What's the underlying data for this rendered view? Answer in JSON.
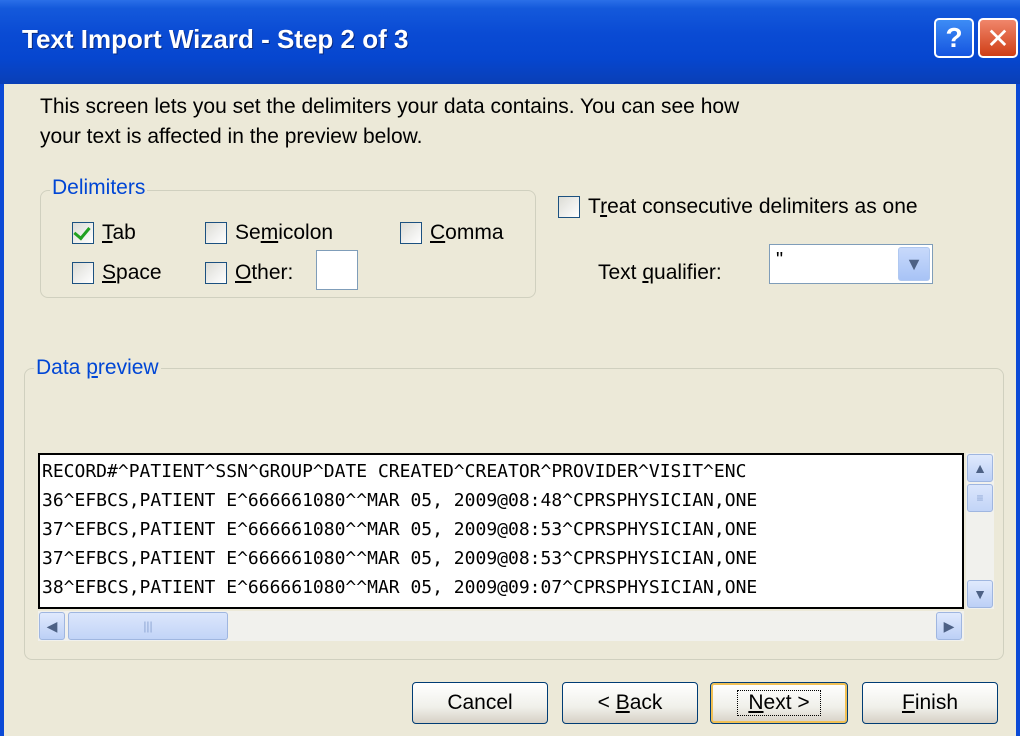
{
  "window": {
    "title": "Text Import Wizard - Step 2 of 3",
    "help_glyph": "?",
    "close_glyph": "✕"
  },
  "description": "This screen lets you set the delimiters your data contains.  You can see how your text is affected in the preview below.",
  "delimiters": {
    "legend": "Delimiters",
    "tab": {
      "label_u": "T",
      "label_rest": "ab",
      "checked": true
    },
    "semicolon": {
      "label_pre": "Se",
      "label_u": "m",
      "label_rest": "icolon",
      "checked": false
    },
    "comma": {
      "label_u": "C",
      "label_rest": "omma",
      "checked": false
    },
    "space": {
      "label_u": "S",
      "label_rest": "pace",
      "checked": false
    },
    "other": {
      "label_u": "O",
      "label_rest": "ther:",
      "checked": false,
      "value": ""
    }
  },
  "consecutive": {
    "label_pre": "T",
    "label_u": "r",
    "label_rest": "eat consecutive delimiters as one",
    "checked": false
  },
  "text_qualifier": {
    "label_pre": "Text ",
    "label_u": "q",
    "label_rest": "ualifier:",
    "value": "\""
  },
  "preview": {
    "legend_pre": "Data ",
    "legend_u": "p",
    "legend_rest": "review",
    "rows": [
      "RECORD#^PATIENT^SSN^GROUP^DATE CREATED^CREATOR^PROVIDER^VISIT^ENC",
      "36^EFBCS,PATIENT E^666661080^^MAR 05, 2009@08:48^CPRSPHYSICIAN,ONE",
      "37^EFBCS,PATIENT E^666661080^^MAR 05, 2009@08:53^CPRSPHYSICIAN,ONE",
      "37^EFBCS,PATIENT E^666661080^^MAR 05, 2009@08:53^CPRSPHYSICIAN,ONE",
      "38^EFBCS,PATIENT E^666661080^^MAR 05, 2009@09:07^CPRSPHYSICIAN,ONE"
    ]
  },
  "buttons": {
    "cancel": "Cancel",
    "back_pre": "< ",
    "back_u": "B",
    "back_rest": "ack",
    "next_u": "N",
    "next_rest": "ext >",
    "finish_u": "F",
    "finish_rest": "inish"
  },
  "colors": {
    "titlebar": "#0a4bd4",
    "legend": "#0046d5",
    "check": "#21a121"
  }
}
